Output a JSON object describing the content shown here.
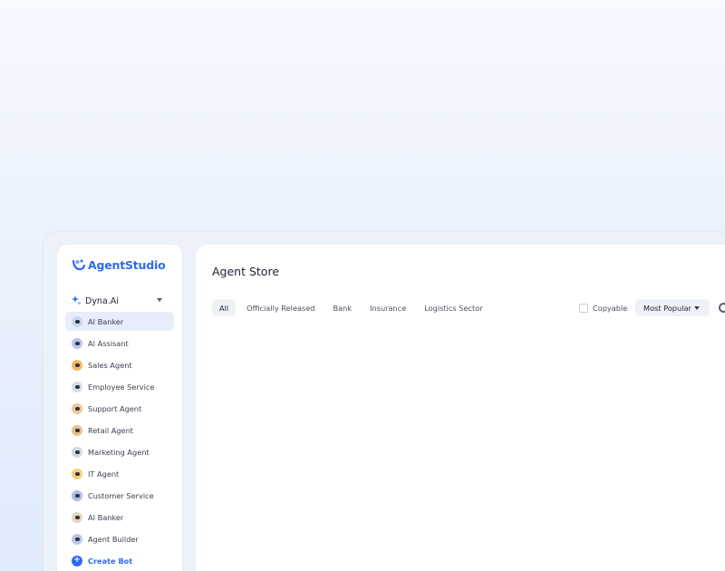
{
  "brand": {
    "name": "AgentStudio",
    "color": "#2f6bf0"
  },
  "workspace": {
    "name": "Dyna.Ai",
    "icon": "sparkle-icon"
  },
  "sidebar": {
    "items": [
      {
        "label": "AI Banker",
        "icon": "ai-banker-avatar-icon",
        "color": "#c9d6ee",
        "active": true
      },
      {
        "label": "AI Assisant",
        "icon": "ai-assistant-avatar-icon",
        "color": "#b7c6ec"
      },
      {
        "label": "Sales Agent",
        "icon": "sales-agent-avatar-icon",
        "color": "#f4b860"
      },
      {
        "label": "Employee Service",
        "icon": "employee-service-avatar-icon",
        "color": "#d9dde6"
      },
      {
        "label": "Support Agent",
        "icon": "support-agent-avatar-icon",
        "color": "#f2c59a"
      },
      {
        "label": "Retail Agent",
        "icon": "retail-agent-avatar-icon",
        "color": "#e6c08a"
      },
      {
        "label": "Marketing Agent",
        "icon": "marketing-agent-avatar-icon",
        "color": "#d4d8e2"
      },
      {
        "label": "IT Agent",
        "icon": "it-agent-avatar-icon",
        "color": "#f7cf7a"
      },
      {
        "label": "Customer Service",
        "icon": "customer-service-avatar-icon",
        "color": "#aebde0"
      },
      {
        "label": "AI Banker",
        "icon": "ai-banker-avatar-icon",
        "color": "#e2d6c2"
      },
      {
        "label": "Agent Builder",
        "icon": "agent-builder-avatar-icon",
        "color": "#b9c7ea"
      }
    ],
    "create_label": "Create Bot",
    "create_icon": "plus-icon"
  },
  "main": {
    "title": "Agent Store",
    "tabs": [
      "All",
      "Officially Released",
      "Bank",
      "Insurance",
      "Logistics Sector"
    ],
    "active_tab": "All",
    "copyable_label": "Copyable",
    "copyable_checked": false,
    "sort_label": "Most Popular",
    "sort_icon": "chevron-down-icon"
  }
}
